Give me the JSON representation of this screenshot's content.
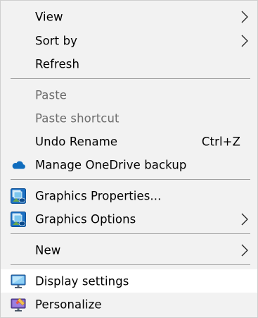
{
  "menu": {
    "view": "View",
    "sort_by": "Sort by",
    "refresh": "Refresh",
    "paste": "Paste",
    "paste_shortcut": "Paste shortcut",
    "undo_rename": "Undo Rename",
    "undo_rename_shortcut": "Ctrl+Z",
    "manage_onedrive": "Manage OneDrive backup",
    "graphics_properties": "Graphics Properties...",
    "graphics_options": "Graphics Options",
    "new": "New",
    "display_settings": "Display settings",
    "personalize": "Personalize"
  },
  "icons": {
    "onedrive": "onedrive-cloud-icon",
    "graphics": "intel-graphics-icon",
    "display": "monitor-icon",
    "personalize": "personalize-icon",
    "submenu": "chevron-right-icon"
  },
  "colors": {
    "menu_background": "#f2f2f2",
    "hover_background": "#ffffff",
    "disabled_text": "#6d6d6d",
    "separator": "#a0a0a0",
    "onedrive_blue": "#0f6cbd"
  }
}
